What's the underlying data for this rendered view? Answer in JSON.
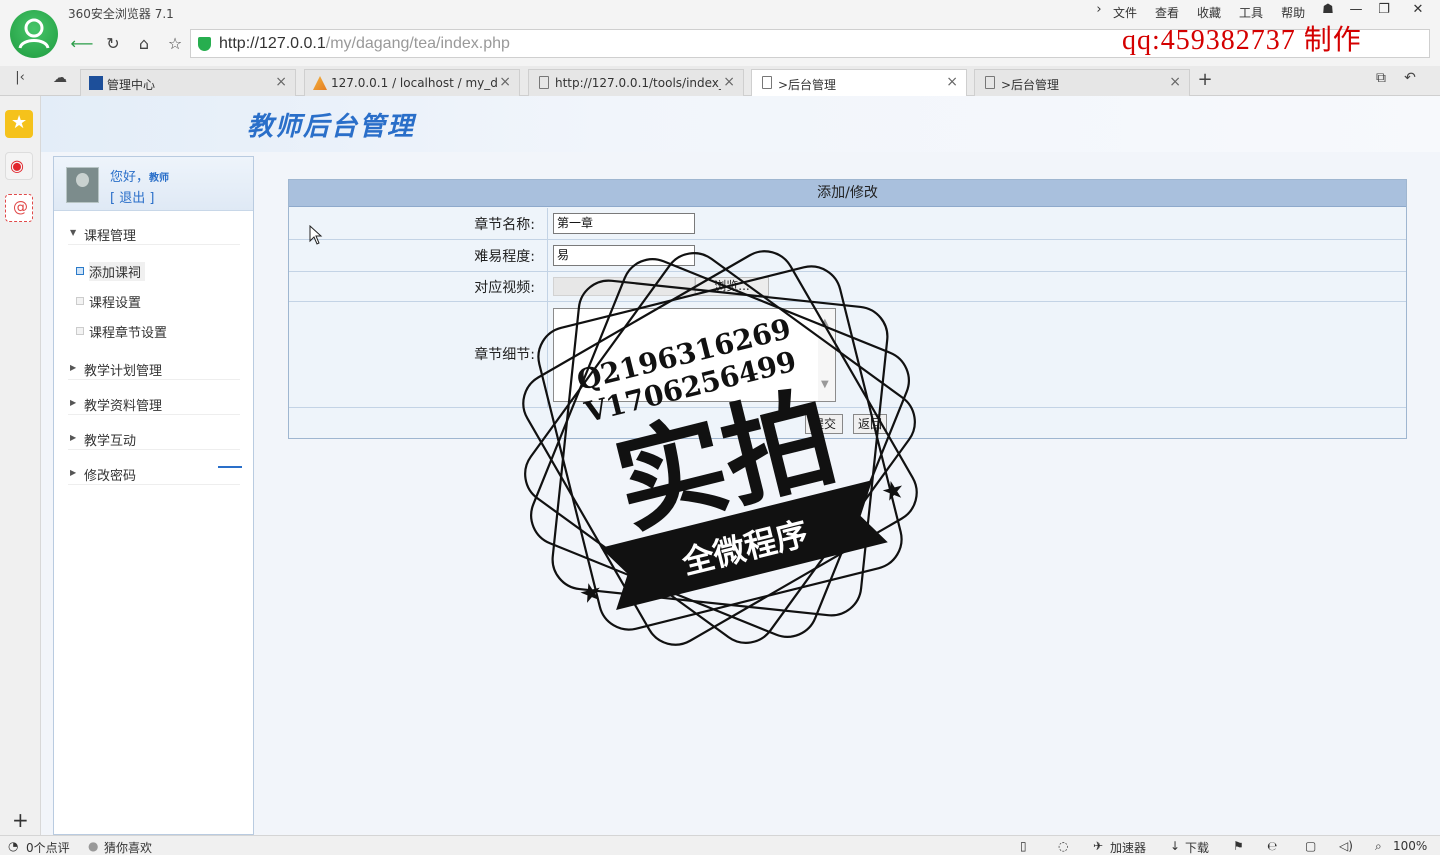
{
  "browser": {
    "title": "360安全浏览器 7.1",
    "menu": [
      "文件",
      "查看",
      "收藏",
      "工具",
      "帮助"
    ],
    "url_host": "http://127.0.0.1",
    "url_path": "/my/dagang/tea/index.php",
    "watermark": "qq:459382737 制作"
  },
  "tabs": [
    {
      "label": "管理中心",
      "active": false
    },
    {
      "label": "127.0.0.1 / localhost / my_da",
      "active": false
    },
    {
      "label": "http://127.0.0.1/tools/index_i",
      "active": false
    },
    {
      "label": ">后台管理",
      "active": true
    },
    {
      "label": ">后台管理",
      "active": false
    }
  ],
  "page": {
    "header_title": "教师后台管理",
    "greeting": "您好，",
    "user_role": "教师",
    "logout": "[ 退出 ]"
  },
  "sidebar": {
    "groups": [
      {
        "label": "课程管理",
        "expanded": true,
        "items": [
          {
            "label": "添加课祠",
            "current": true
          },
          {
            "label": "课程设置",
            "current": false
          },
          {
            "label": "课程章节设置",
            "current": false
          }
        ]
      },
      {
        "label": "教学计划管理",
        "expanded": false
      },
      {
        "label": "教学资料管理",
        "expanded": false
      },
      {
        "label": "教学互动",
        "expanded": false
      },
      {
        "label": "修改密码",
        "expanded": false
      }
    ]
  },
  "form": {
    "heading": "添加/修改",
    "chapter_name_label": "章节名称:",
    "chapter_name_value": "第一章",
    "difficulty_label": "难易程度:",
    "difficulty_value": "易",
    "video_label": "对应视频:",
    "browse_label": "浏览...",
    "detail_label": "章节细节:",
    "submit_label": "提交",
    "back_label": "返回"
  },
  "stamp": {
    "line1": "Q2196316269",
    "line2": "V1706256499",
    "big": "实拍",
    "banner": "全微程序"
  },
  "statusbar": {
    "comments": "0个点评",
    "guess": "猜你喜欢",
    "accelerator": "加速器",
    "download": "下载",
    "zoom": "100%"
  },
  "colors": {
    "accent_blue": "#2a6fc9",
    "form_header": "#a9c0dd",
    "watermark_red": "#d40000"
  }
}
